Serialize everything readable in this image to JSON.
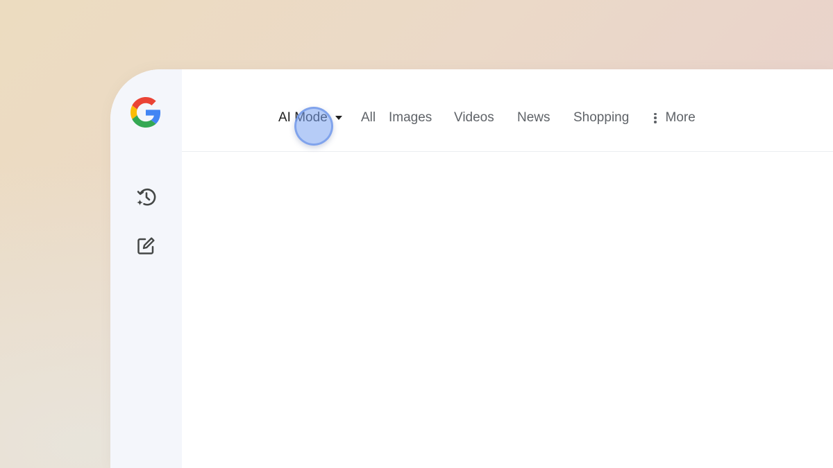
{
  "tabs": {
    "ai_mode": "AI Mode",
    "all": "All",
    "images": "Images",
    "videos": "Videos",
    "news": "News",
    "shopping": "Shopping",
    "more": "More"
  },
  "sidebar": {
    "items": [
      {
        "icon": "history-sparkle-icon"
      },
      {
        "icon": "new-chat-icon"
      }
    ]
  },
  "icons": {
    "logo": "google-g-logo",
    "dropdown": "caret-down-icon",
    "more": "three-dots-vertical-icon"
  },
  "colors": {
    "google_blue": "#4285F4",
    "google_red": "#EA4335",
    "google_yellow": "#FBBC05",
    "google_green": "#34A853",
    "tab_active": "#1f1f1f",
    "tab_inactive": "#5f6368",
    "sidebar_bg": "#f4f6fb",
    "cursor_highlight": "#7aa2f0"
  }
}
